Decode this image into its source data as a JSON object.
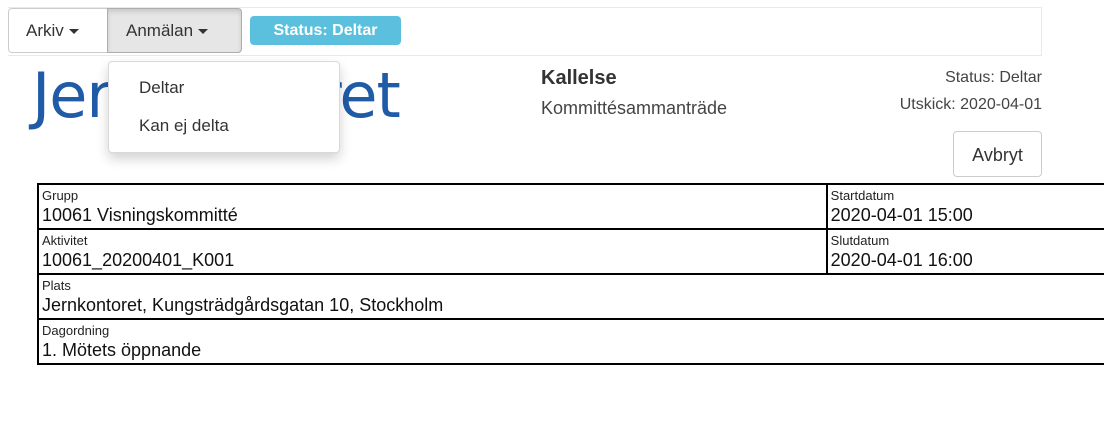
{
  "toolbar": {
    "arkiv_label": "Arkiv",
    "anmalan_label": "Anmälan",
    "status_badge": "Status: Deltar"
  },
  "dropdown": {
    "items": [
      {
        "label": "Deltar"
      },
      {
        "label": "Kan ej delta"
      }
    ]
  },
  "logo": {
    "text": "Jernkontoret"
  },
  "header": {
    "title": "Kallelse",
    "subtitle": "Kommittésammanträde",
    "status": "Status: Deltar",
    "utskick": "Utskick: 2020-04-01",
    "cancel_label": "Avbryt"
  },
  "fields": {
    "grupp": {
      "label": "Grupp",
      "value": "10061 Visningskommitté"
    },
    "startdatum": {
      "label": "Startdatum",
      "value": "2020-04-01 15:00"
    },
    "aktivitet": {
      "label": "Aktivitet",
      "value": "10061_20200401_K001"
    },
    "slutdatum": {
      "label": "Slutdatum",
      "value": "2020-04-01 16:00"
    },
    "plats": {
      "label": "Plats",
      "value": "Jernkontoret, Kungsträdgårdsgatan 10, Stockholm"
    },
    "dagordning": {
      "label": "Dagordning",
      "value": "1. Mötets öppnande"
    }
  },
  "colors": {
    "badge": "#5bc0de",
    "logo": "#1f5ba7"
  }
}
